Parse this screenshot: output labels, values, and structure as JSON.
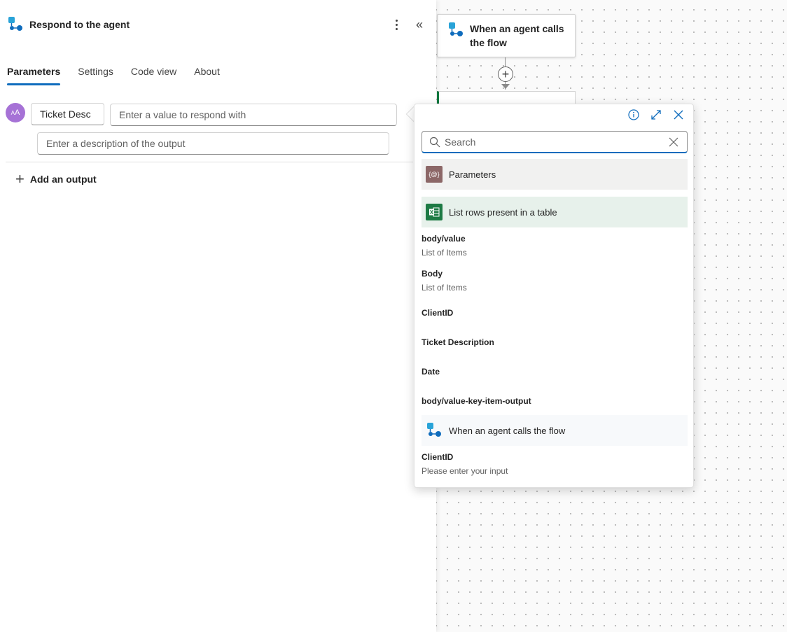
{
  "panel": {
    "title": "Respond to the agent",
    "tabs": [
      "Parameters",
      "Settings",
      "Code view",
      "About"
    ],
    "active_tab": "Parameters",
    "output": {
      "avatar_text": "AA",
      "name_value": "Ticket Desc",
      "value_placeholder": "Enter a value to respond with",
      "description_placeholder": "Enter a description of the output"
    },
    "add_output_label": "Add an output"
  },
  "canvas": {
    "trigger_card_title": "When an agent calls the flow"
  },
  "popup": {
    "search_placeholder": "Search",
    "groups": {
      "parameters": "Parameters",
      "excel": "List rows present in a table",
      "agent": "When an agent calls the flow"
    },
    "excel_tokens": [
      {
        "name": "body/value",
        "desc": "List of Items"
      },
      {
        "name": "Body",
        "desc": "List of Items"
      },
      {
        "name": "ClientID",
        "desc": ""
      },
      {
        "name": "Ticket Description",
        "desc": ""
      },
      {
        "name": "Date",
        "desc": ""
      },
      {
        "name": "body/value-key-item-output",
        "desc": ""
      }
    ],
    "agent_tokens": [
      {
        "name": "ClientID",
        "desc": "Please enter your input"
      }
    ]
  },
  "colors": {
    "accent": "#0f6cbd",
    "avatar": "#a672d6",
    "excel_green": "#1d7a44",
    "params_brown": "#8c6767"
  }
}
